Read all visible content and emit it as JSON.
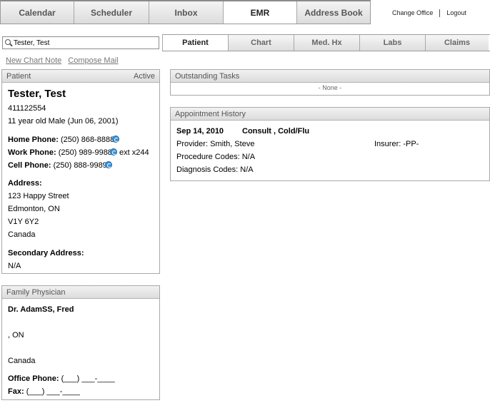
{
  "top_nav": {
    "tabs": [
      {
        "label": "Calendar"
      },
      {
        "label": "Scheduler"
      },
      {
        "label": "Inbox"
      },
      {
        "label": "EMR"
      },
      {
        "label": "Address Book"
      }
    ],
    "active": "EMR",
    "change_office": "Change Office",
    "logout": "Logout"
  },
  "search": {
    "value": "Tester, Test",
    "icon": "search-icon"
  },
  "sub_nav": {
    "tabs": [
      {
        "label": "Patient"
      },
      {
        "label": "Chart"
      },
      {
        "label": "Med. Hx"
      },
      {
        "label": "Labs"
      },
      {
        "label": "Claims"
      }
    ],
    "active": "Patient"
  },
  "quick_links": {
    "new_chart_note": "New Chart Note",
    "compose_mail": "Compose Mail"
  },
  "patient": {
    "header": "Patient",
    "status": "Active",
    "name": "Tester, Test",
    "id": "411122554",
    "summary": "11 year old Male (Jun 06, 2001)",
    "home_phone_label": "Home Phone:",
    "home_phone": "(250) 868-8888",
    "work_phone_label": "Work Phone:",
    "work_phone": "(250) 989-9988",
    "work_ext": "ext x244",
    "cell_phone_label": "Cell Phone:",
    "cell_phone": "(250) 888-9989",
    "address_label": "Address:",
    "address_lines": [
      "123 Happy Street",
      "Edmonton, ON",
      "V1Y 6Y2",
      "Canada"
    ],
    "secondary_address_label": "Secondary Address:",
    "secondary_address": "N/A"
  },
  "family_physician": {
    "header": "Family Physician",
    "name": "Dr. AdamSS, Fred",
    "city_province": ", ON",
    "country": "Canada",
    "office_phone_label": "Office Phone:",
    "office_phone": "(___) ___-____",
    "fax_label": "Fax:",
    "fax": "(___) ___-____"
  },
  "outstanding_tasks": {
    "header": "Outstanding Tasks",
    "empty": "- None -"
  },
  "appointment_history": {
    "header": "Appointment History",
    "date": "Sep 14, 2010",
    "type": "Consult , Cold/Flu",
    "provider": "Provider: Smith, Steve",
    "insurer": "Insurer: -PP-",
    "procedure_codes": "Procedure Codes: N/A",
    "diagnosis_codes": "Diagnosis Codes: N/A"
  },
  "colors": {
    "phone_icon": "#3b92d8",
    "panel_header": "#e4e4e4",
    "link": "#777777"
  }
}
